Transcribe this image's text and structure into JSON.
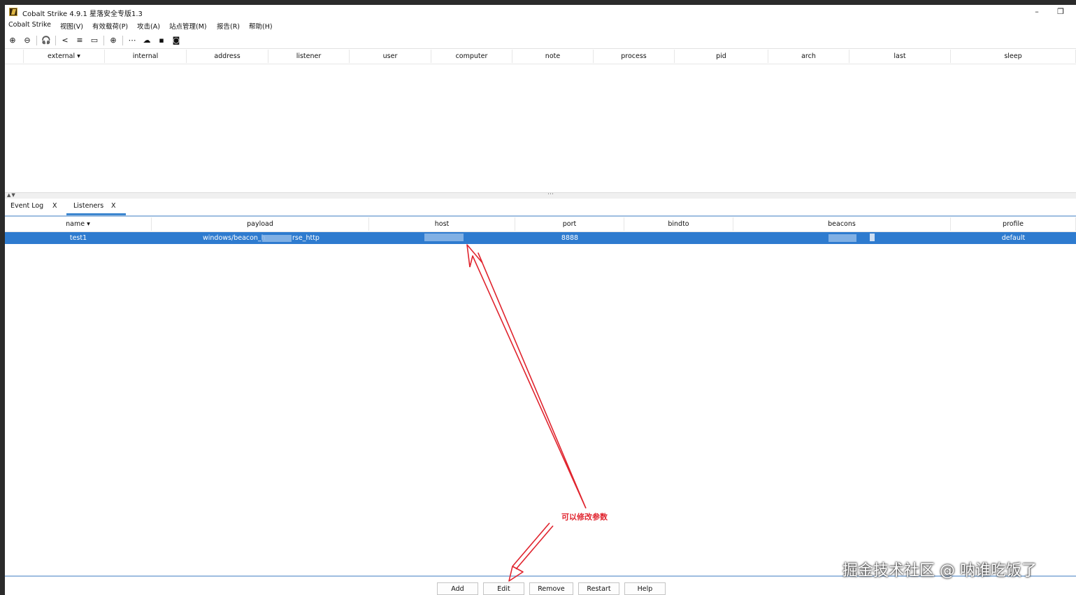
{
  "window": {
    "title": "Cobalt Strike 4.9.1 星落安全专版1.3",
    "minimize_glyph": "–",
    "restore_glyph": "❐"
  },
  "menu": [
    "Cobalt Strike",
    "视图(V)",
    "有效载荷(P)",
    "攻击(A)",
    "站点管理(M)",
    "报告(R)",
    "帮助(H)"
  ],
  "toolbar_icons": [
    {
      "name": "new-connection-icon",
      "glyph": "⊕"
    },
    {
      "name": "disconnect-icon",
      "glyph": "⊖"
    },
    {
      "name": "headphones-icon",
      "glyph": "🎧"
    },
    {
      "name": "share-icon",
      "glyph": "<"
    },
    {
      "name": "list-icon",
      "glyph": "≡"
    },
    {
      "name": "laptop-icon",
      "glyph": "▭"
    },
    {
      "name": "globe-icon",
      "glyph": "⊕"
    },
    {
      "name": "keys-icon",
      "glyph": "⋯"
    },
    {
      "name": "cloud-upload-icon",
      "glyph": "☁"
    },
    {
      "name": "terminal-icon",
      "glyph": "▪"
    },
    {
      "name": "camera-icon",
      "glyph": "◙"
    }
  ],
  "sessions_table": {
    "columns": [
      "",
      "external ▾",
      "internal",
      "address",
      "listener",
      "user",
      "computer",
      "note",
      "process",
      "pid",
      "arch",
      "last",
      "sleep"
    ]
  },
  "splitter": {
    "arrows": "▲▼",
    "handle": "⋯"
  },
  "tabs": [
    {
      "label": "Event Log",
      "close": "X",
      "active": false
    },
    {
      "label": "Listeners",
      "close": "X",
      "active": true
    }
  ],
  "listeners_table": {
    "columns": [
      "name ▾",
      "payload",
      "host",
      "port",
      "bindto",
      "beacons",
      "profile"
    ],
    "rows": [
      {
        "name": "test1",
        "payload_start": "windows/beacon_h",
        "payload_end": "rse_http",
        "host": "",
        "port": "8888",
        "bindto": "",
        "beacons": "",
        "profile": "default"
      }
    ]
  },
  "buttons": [
    "Add",
    "Edit",
    "Remove",
    "Restart",
    "Help"
  ],
  "annotation": {
    "text": "可以修改参数",
    "color": "#e0242e"
  },
  "watermark": "掘金技术社区 @ 呐谁吃饭了"
}
